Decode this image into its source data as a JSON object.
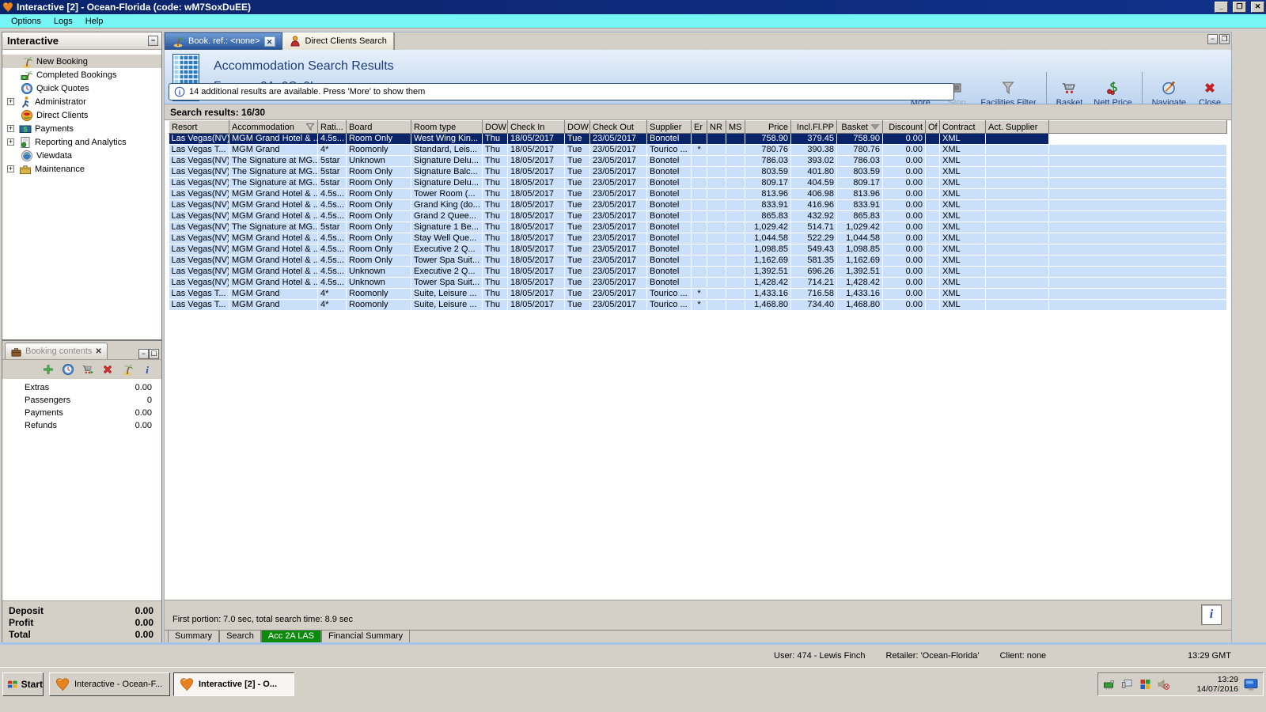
{
  "window": {
    "title": "Interactive [2] - Ocean-Florida (code: wM7SoxDuEE)",
    "menu": [
      "Options",
      "Logs",
      "Help"
    ],
    "controls": [
      "minimize",
      "maximize",
      "close"
    ]
  },
  "sidebar": {
    "title": "Interactive",
    "tree": [
      {
        "label": "New Booking",
        "icon": "palm",
        "expandable": false,
        "selected": true
      },
      {
        "label": "Completed Bookings",
        "icon": "money-palm",
        "expandable": false
      },
      {
        "label": "Quick Quotes",
        "icon": "clock-globe",
        "expandable": false
      },
      {
        "label": "Administrator",
        "icon": "runner",
        "expandable": true
      },
      {
        "label": "Direct Clients",
        "icon": "globe-red",
        "expandable": false
      },
      {
        "label": "Payments",
        "icon": "money",
        "expandable": true
      },
      {
        "label": "Reporting and Analytics",
        "icon": "report",
        "expandable": true
      },
      {
        "label": "Viewdata",
        "icon": "globe",
        "expandable": false
      },
      {
        "label": "Maintenance",
        "icon": "toolbox",
        "expandable": true
      }
    ]
  },
  "booking_panel": {
    "title": "Booking contents",
    "toolbar_icons": [
      "add",
      "clock-globe",
      "cart-go",
      "delete",
      "palm",
      "info"
    ],
    "rows": [
      {
        "label": "Extras",
        "value": "0.00"
      },
      {
        "label": "Passengers",
        "value": "0"
      },
      {
        "label": "Payments",
        "value": "0.00"
      },
      {
        "label": "Refunds",
        "value": "0.00"
      }
    ],
    "totals": [
      {
        "label": "Deposit",
        "value": "0.00"
      },
      {
        "label": "Profit",
        "value": "0.00"
      },
      {
        "label": "Total",
        "value": "0.00"
      }
    ]
  },
  "main": {
    "tabs": [
      {
        "label": "Book. ref.: <none>",
        "icon": "palm",
        "closable": true,
        "active": true
      },
      {
        "label": "Direct Clients Search",
        "icon": "client",
        "closable": false,
        "active": false
      }
    ],
    "header": {
      "title": "Accommodation Search Results",
      "subtitle": "For pax: 2A, 0C, 0I",
      "notice": "14 additional results are available. Press 'More' to show them"
    },
    "toolbar": [
      {
        "label": "More",
        "icon": "more",
        "enabled": true
      },
      {
        "label": "Stop",
        "icon": "stop",
        "enabled": false
      },
      {
        "label": "Facilities Filter",
        "icon": "funnel",
        "enabled": true
      },
      {
        "sep": true
      },
      {
        "label": "Basket",
        "icon": "basket",
        "enabled": true
      },
      {
        "label": "Nett Price",
        "icon": "nett",
        "enabled": true
      },
      {
        "sep": true
      },
      {
        "label": "Navigate",
        "icon": "navigate",
        "enabled": true
      },
      {
        "label": "Close",
        "icon": "close-red",
        "enabled": true
      }
    ],
    "results_label": "Search results: 16/30",
    "status_line": "First portion: 7.0 sec, total search time: 8.9 sec",
    "bottom_tabs": [
      {
        "label": "Summary",
        "active": false
      },
      {
        "label": "Search",
        "active": false
      },
      {
        "label": "Acc 2A LAS",
        "active": true
      },
      {
        "label": "Financial Summary",
        "active": false
      }
    ]
  },
  "table": {
    "selected_index": 0,
    "columns": [
      {
        "label": "Resort"
      },
      {
        "label": "Accommodation",
        "filter": true
      },
      {
        "label": "Rati..."
      },
      {
        "label": "Board"
      },
      {
        "label": "Room type"
      },
      {
        "label": "DOW"
      },
      {
        "label": "Check In"
      },
      {
        "label": "DOW"
      },
      {
        "label": "Check Out"
      },
      {
        "label": "Supplier"
      },
      {
        "label": "Er"
      },
      {
        "label": "NR"
      },
      {
        "label": "MS"
      },
      {
        "label": "Price",
        "align": "right"
      },
      {
        "label": "Incl.Fl.PP",
        "align": "right"
      },
      {
        "label": "Basket",
        "align": "right",
        "sort": true
      },
      {
        "label": "Discount",
        "align": "right"
      },
      {
        "label": "Of"
      },
      {
        "label": "Contract"
      },
      {
        "label": "Act. Supplier"
      }
    ],
    "rows": [
      [
        "Las Vegas(NV)",
        "MGM Grand Hotel & ...",
        "4.5s...",
        "Room Only",
        "West Wing Kin...",
        "Thu",
        "18/05/2017",
        "Tue",
        "23/05/2017",
        "Bonotel",
        "",
        "",
        "",
        "758.90",
        "379.45",
        "758.90",
        "0.00",
        "",
        "XML",
        ""
      ],
      [
        "Las Vegas T...",
        "MGM Grand",
        "4*",
        "Roomonly",
        "Standard, Leis...",
        "Thu",
        "18/05/2017",
        "Tue",
        "23/05/2017",
        "Tourico ...",
        "*",
        "",
        "",
        "780.76",
        "390.38",
        "780.76",
        "0.00",
        "",
        "XML",
        ""
      ],
      [
        "Las Vegas(NV)",
        "The Signature at MG...",
        "5star",
        "Unknown",
        "Signature Delu...",
        "Thu",
        "18/05/2017",
        "Tue",
        "23/05/2017",
        "Bonotel",
        "",
        "",
        "",
        "786.03",
        "393.02",
        "786.03",
        "0.00",
        "",
        "XML",
        ""
      ],
      [
        "Las Vegas(NV)",
        "The Signature at MG...",
        "5star",
        "Room Only",
        "Signature Balc...",
        "Thu",
        "18/05/2017",
        "Tue",
        "23/05/2017",
        "Bonotel",
        "",
        "",
        "",
        "803.59",
        "401.80",
        "803.59",
        "0.00",
        "",
        "XML",
        ""
      ],
      [
        "Las Vegas(NV)",
        "The Signature at MG...",
        "5star",
        "Room Only",
        "Signature Delu...",
        "Thu",
        "18/05/2017",
        "Tue",
        "23/05/2017",
        "Bonotel",
        "",
        "",
        "",
        "809.17",
        "404.59",
        "809.17",
        "0.00",
        "",
        "XML",
        ""
      ],
      [
        "Las Vegas(NV)",
        "MGM Grand Hotel & ...",
        "4.5s...",
        "Room Only",
        "Tower Room (...",
        "Thu",
        "18/05/2017",
        "Tue",
        "23/05/2017",
        "Bonotel",
        "",
        "",
        "",
        "813.96",
        "406.98",
        "813.96",
        "0.00",
        "",
        "XML",
        ""
      ],
      [
        "Las Vegas(NV)",
        "MGM Grand Hotel & ...",
        "4.5s...",
        "Room Only",
        "Grand King (do...",
        "Thu",
        "18/05/2017",
        "Tue",
        "23/05/2017",
        "Bonotel",
        "",
        "",
        "",
        "833.91",
        "416.96",
        "833.91",
        "0.00",
        "",
        "XML",
        ""
      ],
      [
        "Las Vegas(NV)",
        "MGM Grand Hotel & ...",
        "4.5s...",
        "Room Only",
        "Grand 2 Quee...",
        "Thu",
        "18/05/2017",
        "Tue",
        "23/05/2017",
        "Bonotel",
        "",
        "",
        "",
        "865.83",
        "432.92",
        "865.83",
        "0.00",
        "",
        "XML",
        ""
      ],
      [
        "Las Vegas(NV)",
        "The Signature at MG...",
        "5star",
        "Room Only",
        "Signature 1 Be...",
        "Thu",
        "18/05/2017",
        "Tue",
        "23/05/2017",
        "Bonotel",
        "",
        "",
        "",
        "1,029.42",
        "514.71",
        "1,029.42",
        "0.00",
        "",
        "XML",
        ""
      ],
      [
        "Las Vegas(NV)",
        "MGM Grand Hotel & ...",
        "4.5s...",
        "Room Only",
        "Stay Well Que...",
        "Thu",
        "18/05/2017",
        "Tue",
        "23/05/2017",
        "Bonotel",
        "",
        "",
        "",
        "1,044.58",
        "522.29",
        "1,044.58",
        "0.00",
        "",
        "XML",
        ""
      ],
      [
        "Las Vegas(NV)",
        "MGM Grand Hotel & ...",
        "4.5s...",
        "Room Only",
        "Executive 2 Q...",
        "Thu",
        "18/05/2017",
        "Tue",
        "23/05/2017",
        "Bonotel",
        "",
        "",
        "",
        "1,098.85",
        "549.43",
        "1,098.85",
        "0.00",
        "",
        "XML",
        ""
      ],
      [
        "Las Vegas(NV)",
        "MGM Grand Hotel & ...",
        "4.5s...",
        "Room Only",
        "Tower Spa Suit...",
        "Thu",
        "18/05/2017",
        "Tue",
        "23/05/2017",
        "Bonotel",
        "",
        "",
        "",
        "1,162.69",
        "581.35",
        "1,162.69",
        "0.00",
        "",
        "XML",
        ""
      ],
      [
        "Las Vegas(NV)",
        "MGM Grand Hotel & ...",
        "4.5s...",
        "Unknown",
        "Executive 2 Q...",
        "Thu",
        "18/05/2017",
        "Tue",
        "23/05/2017",
        "Bonotel",
        "",
        "",
        "",
        "1,392.51",
        "696.26",
        "1,392.51",
        "0.00",
        "",
        "XML",
        ""
      ],
      [
        "Las Vegas(NV)",
        "MGM Grand Hotel & ...",
        "4.5s...",
        "Unknown",
        "Tower Spa Suit...",
        "Thu",
        "18/05/2017",
        "Tue",
        "23/05/2017",
        "Bonotel",
        "",
        "",
        "",
        "1,428.42",
        "714.21",
        "1,428.42",
        "0.00",
        "",
        "XML",
        ""
      ],
      [
        "Las Vegas T...",
        "MGM Grand",
        "4*",
        "Roomonly",
        "Suite, Leisure ...",
        "Thu",
        "18/05/2017",
        "Tue",
        "23/05/2017",
        "Tourico ...",
        "*",
        "",
        "",
        "1,433.16",
        "716.58",
        "1,433.16",
        "0.00",
        "",
        "XML",
        ""
      ],
      [
        "Las Vegas T...",
        "MGM Grand",
        "4*",
        "Roomonly",
        "Suite, Leisure ...",
        "Thu",
        "18/05/2017",
        "Tue",
        "23/05/2017",
        "Tourico ...",
        "*",
        "",
        "",
        "1,468.80",
        "734.40",
        "1,468.80",
        "0.00",
        "",
        "XML",
        ""
      ]
    ]
  },
  "status_bar": {
    "user": "User: 474 - Lewis Finch",
    "retailer": "Retailer: 'Ocean-Florida'",
    "client": "Client: none",
    "time": "13:29 GMT"
  },
  "taskbar": {
    "start": "Start",
    "tasks": [
      {
        "label": "Interactive - Ocean-F...",
        "active": false
      },
      {
        "label": "Interactive [2] - O...",
        "active": true
      }
    ],
    "tray": {
      "icons": [
        "network",
        "display",
        "winlogo",
        "mute"
      ],
      "time": "13:29",
      "date": "14/07/2016"
    }
  },
  "colors": {
    "titlebar_navy": "#0a246a",
    "menubar_cyan": "#76f5f5",
    "row_blue": "#c9dffa",
    "selected_navy": "#0a246a",
    "active_tab_green": "#0c8a0c",
    "header_blue": "#cfe2f6"
  }
}
